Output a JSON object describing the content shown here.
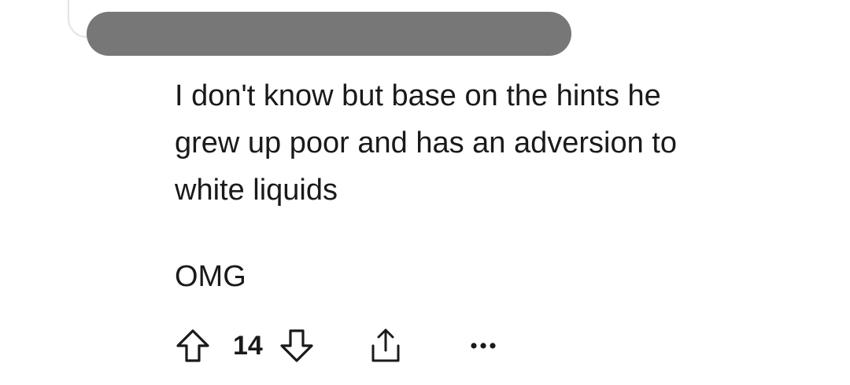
{
  "comment": {
    "body_paragraphs": [
      "I don't know but base on the hints he\ngrew up poor and has an adversion to\nwhite liquids",
      "OMG"
    ],
    "vote_count": "14"
  },
  "icons": {
    "upvote": "arrow-up-outline-icon",
    "downvote": "arrow-down-outline-icon",
    "share": "share-upload-icon",
    "more": "more-dots-icon"
  },
  "colors": {
    "text": "#1a1a1a",
    "redaction": "#777777",
    "thread_line": "#e3e3e3",
    "background": "#ffffff"
  }
}
